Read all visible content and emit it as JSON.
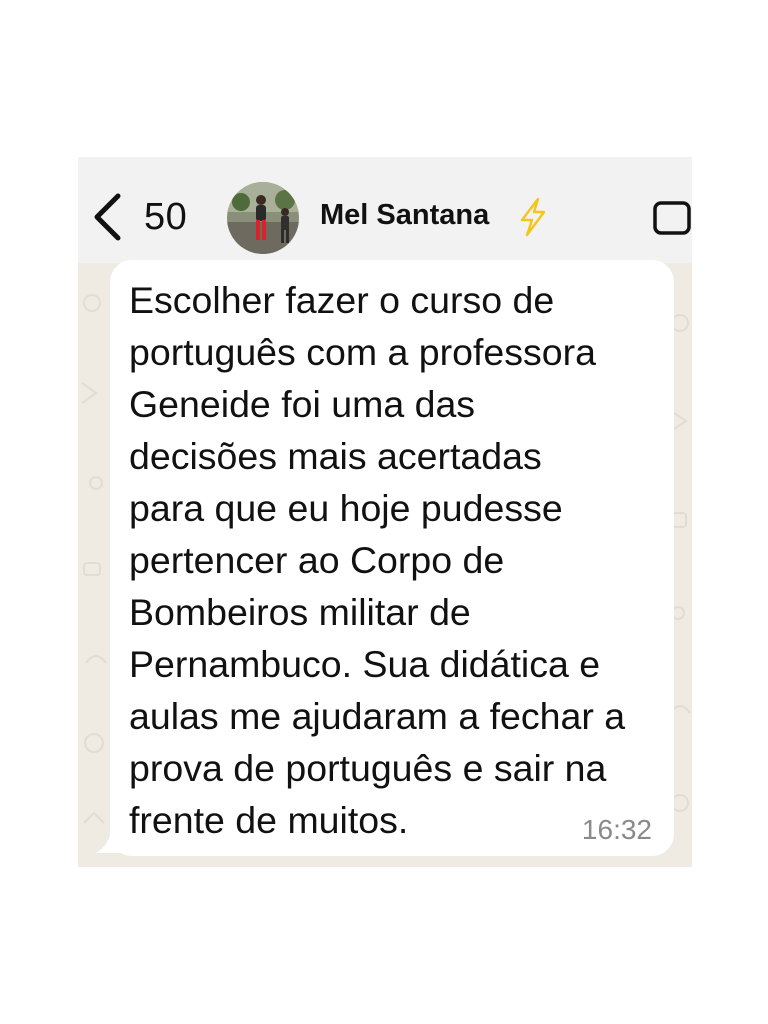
{
  "header": {
    "back_count": "50",
    "contact_name": "Mel Santana",
    "name_emoji_icon": "lightning-bolt-icon",
    "call_icon": "video-call-icon"
  },
  "message": {
    "text": "Escolher fazer o curso de\nportuguês com a professora\nGeneide foi uma das\ndecisões mais acertadas\npara que eu hoje pudesse\npertencer ao Corpo de\nBombeiros militar de\nPernambuco. Sua didática e\naulas me ajudaram a fechar a\nprova de português e sair na\nfrente de muitos.",
    "time": "16:32"
  },
  "colors": {
    "header_bg": "#f2f2f2",
    "chat_bg": "#efeae2",
    "bubble_bg": "#ffffff",
    "bolt": "#f5c518",
    "timestamp": "#8a8a8a"
  }
}
